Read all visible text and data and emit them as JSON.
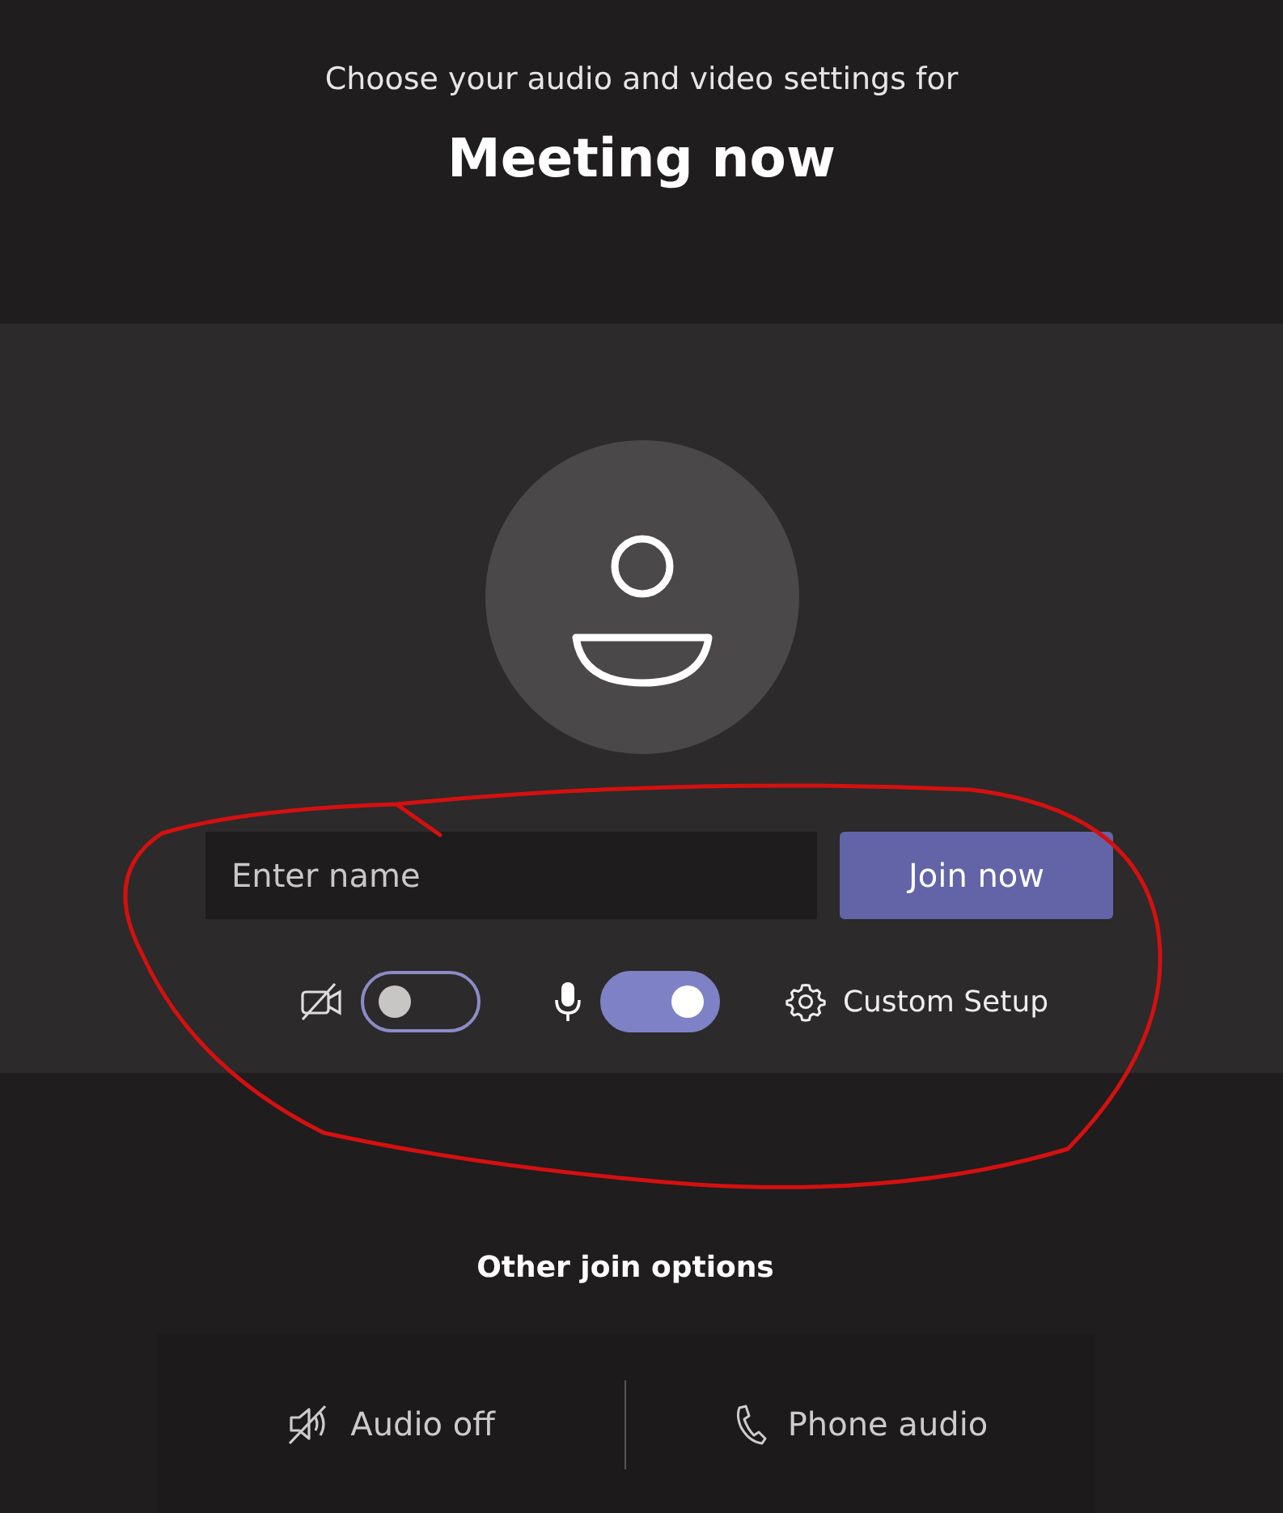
{
  "header": {
    "subtitle": "Choose your audio and video settings for",
    "title": "Meeting now"
  },
  "name_field": {
    "placeholder": "Enter name"
  },
  "join_button": {
    "label": "Join now"
  },
  "toggles": [
    {
      "kind": "camera",
      "on": false
    },
    {
      "kind": "microphone",
      "on": true
    }
  ],
  "custom_setup": {
    "label": "Custom Setup"
  },
  "other_options": {
    "heading": "Other join options",
    "items": [
      {
        "kind": "audio_off",
        "label": "Audio off"
      },
      {
        "kind": "phone",
        "label": "Phone audio"
      }
    ]
  }
}
